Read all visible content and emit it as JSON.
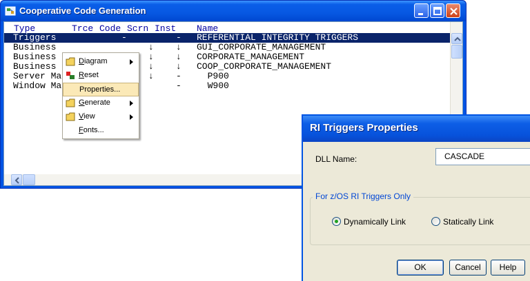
{
  "window": {
    "title": "Cooperative Code Generation"
  },
  "list": {
    "headers": {
      "type": "Type",
      "trce": "Trce",
      "code": "Code",
      "scrn": "Scrn",
      "inst": "Inst",
      "name": "Name"
    },
    "rows": [
      {
        "type": "Triggers",
        "trce": "",
        "code": "-",
        "scrn": "",
        "inst": "-",
        "name": "REFERENTIAL INTEGRITY TRIGGERS",
        "selected": true
      },
      {
        "type": "Business",
        "trce": "",
        "code": "",
        "scrn": "↓",
        "inst": "↓",
        "name": "GUI_CORPORATE_MANAGEMENT",
        "selected": false
      },
      {
        "type": "Business",
        "trce": "",
        "code": "",
        "scrn": "↓",
        "inst": "↓",
        "name": "CORPORATE_MANAGEMENT",
        "selected": false
      },
      {
        "type": "Business",
        "trce": "",
        "code": "",
        "scrn": "↓",
        "inst": "↓",
        "name": "COOP_CORPORATE_MANAGEMENT",
        "selected": false
      },
      {
        "type": "Server Ma",
        "trce": "",
        "code": "",
        "scrn": "↓",
        "inst": "-",
        "name": "  P900",
        "selected": false
      },
      {
        "type": "Window Ma",
        "trce": "",
        "code": "",
        "scrn": "",
        "inst": "-",
        "name": "  W900",
        "selected": false
      }
    ]
  },
  "context_menu": {
    "items": [
      {
        "label": "Diagram",
        "accel": "D",
        "submenu": true,
        "icon": "folder-icon"
      },
      {
        "label": "Reset",
        "accel": "R",
        "submenu": false,
        "icon": "reset-icon"
      },
      {
        "label": "Properties...",
        "accel": "",
        "submenu": false,
        "icon": ""
      },
      {
        "label": "Generate",
        "accel": "G",
        "submenu": true,
        "icon": "folder-icon"
      },
      {
        "label": "View",
        "accel": "V",
        "submenu": true,
        "icon": "folder-icon"
      },
      {
        "label": "Fonts...",
        "accel": "F",
        "submenu": false,
        "icon": ""
      }
    ],
    "highlighted": "Properties..."
  },
  "dialog": {
    "title": "RI Triggers Properties",
    "dll_label": "DLL Name:",
    "dll_value": "CASCADE",
    "group_label": "For z/OS RI Triggers Only",
    "radio_dynamic": "Dynamically Link",
    "radio_static": "Statically Link",
    "selected_link": "dynamic",
    "ok_label": "OK",
    "cancel_label": "Cancel",
    "help_label": "Help"
  },
  "colors": {
    "xp_blue": "#0054e3",
    "selection": "#0a246a",
    "menu_highlight": "#fbe9b7",
    "group_label": "#0046d5",
    "radio_dot": "#21a121"
  }
}
